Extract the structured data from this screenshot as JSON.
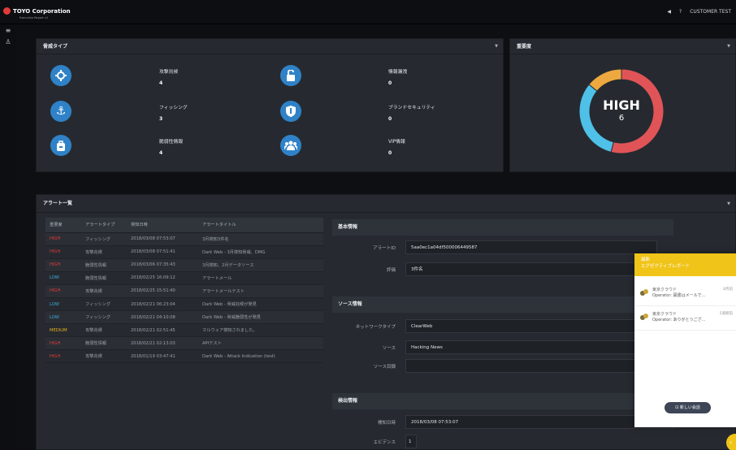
{
  "header": {
    "company": "TOYO Corporation",
    "tagline": "Executive Report v1",
    "user": "CUSTOMER TEST",
    "help": "?",
    "bell": "◀"
  },
  "threat_panel": {
    "title": "脅威タイプ",
    "items": [
      {
        "label": "攻撃兆候",
        "count": "4",
        "icon": "crosshair-icon"
      },
      {
        "label": "情報漏洩",
        "count": "0",
        "icon": "unlock-icon"
      },
      {
        "label": "フィッシング",
        "count": "3",
        "icon": "anchor-icon"
      },
      {
        "label": "ブランドセキュリティ",
        "count": "0",
        "icon": "shield-icon"
      },
      {
        "label": "脆弱性情報",
        "count": "4",
        "icon": "bag-icon"
      },
      {
        "label": "VIP情報",
        "count": "0",
        "icon": "users-icon"
      }
    ]
  },
  "severity_panel": {
    "title": "重要度",
    "label": "HIGH",
    "value": "6",
    "segments": [
      {
        "name": "HIGH",
        "share": 0.54,
        "color": "#e05457"
      },
      {
        "name": "LOW",
        "share": 0.32,
        "color": "#4fc0e8"
      },
      {
        "name": "MEDIUM",
        "share": 0.14,
        "color": "#eda940"
      }
    ]
  },
  "alert_list": {
    "title": "アラート一覧",
    "columns": [
      "重要度",
      "アラートタイプ",
      "検知日時",
      "アラートタイトル"
    ],
    "rows": [
      {
        "severity": "HIGH",
        "type": "フィッシング",
        "date": "2018/03/08 07:53:07",
        "title": "3月検知3件名"
      },
      {
        "severity": "HIGH",
        "type": "攻撃兆候",
        "date": "2018/03/08 07:51:41",
        "title": "Dark Web - 3月検知脅威、DMG"
      },
      {
        "severity": "HIGH",
        "type": "脆弱性情報",
        "date": "2018/03/06 07:35:43",
        "title": "3月検知、2月データソース"
      },
      {
        "severity": "LOW",
        "type": "脆弱性情報",
        "date": "2018/02/25 16:09:12",
        "title": "アラートメール"
      },
      {
        "severity": "HIGH",
        "type": "攻撃兆候",
        "date": "2018/02/25 15:51:40",
        "title": "アラートメールテスト"
      },
      {
        "severity": "LOW",
        "type": "フィッシング",
        "date": "2018/02/21 06:23:04",
        "title": "Dark Web - 脅威兆候が発見"
      },
      {
        "severity": "LOW",
        "type": "フィッシング",
        "date": "2018/02/21 04:10:08",
        "title": "Dark Web - 脅威脆弱性が発見"
      },
      {
        "severity": "MEDIUM",
        "type": "攻撃兆候",
        "date": "2018/02/21 02:51:45",
        "title": "マルウェア検知されました。"
      },
      {
        "severity": "HIGH",
        "type": "脆弱性情報",
        "date": "2018/02/21 02:13:03",
        "title": "APIテスト"
      },
      {
        "severity": "HIGH",
        "type": "攻撃兆候",
        "date": "2018/01/19 03:47:41",
        "title": "Dark Web - Attack Indication (test)"
      }
    ]
  },
  "detail": {
    "basic_title": "基本情報",
    "alert_id_label": "アラートID",
    "alert_id": "5aa0ec1a04df500006449587",
    "summary_label": "評価",
    "summary": "3件名",
    "source_title": "ソース情報",
    "network_label": "ネットワークタイプ",
    "network": "ClearWeb",
    "source_label": "ソース",
    "source": "Hacking News",
    "source_items_label": "ソース目録",
    "source_items": "",
    "detect_title": "検出情報",
    "detect_date_label": "検知日時",
    "detect_date": "2018/03/08 07:53:07",
    "evidence_label": "エビデンス",
    "evidence": "1"
  },
  "chat": {
    "title": "最新\nエグゼクティブレポート",
    "messages": [
      {
        "name": "東京クラウド",
        "time": "8月前",
        "text": "Operator: 図書はメールで..."
      },
      {
        "name": "東京クラウド",
        "time": "5週間前",
        "text": "Operator: ありがとうござ..."
      }
    ],
    "new_button": "⊡ 新しい会話",
    "fab": "›"
  }
}
